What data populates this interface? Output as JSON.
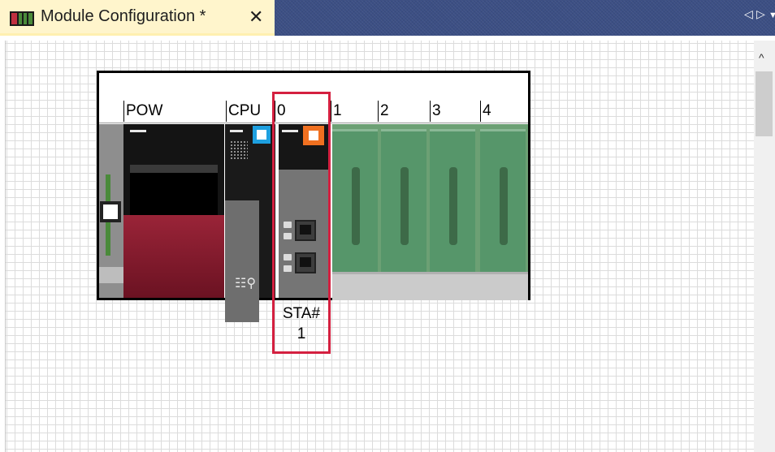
{
  "tab": {
    "title": "Module Configuration *",
    "close_glyph": "✕",
    "icon": "module-config-icon",
    "nav_left": "◁",
    "nav_right": "▷",
    "menu": "▼"
  },
  "scrollbar": {
    "up": "^"
  },
  "base": {
    "slots": [
      "POW",
      "CPU",
      "0",
      "1",
      "2",
      "3",
      "4"
    ]
  },
  "modules": {
    "cpu_icons": "☷⚲",
    "station_line1": "STA#",
    "station_line2": "1"
  },
  "colors": {
    "tab_active": "#fff5cc",
    "tabbar": "#3c4f84",
    "selection": "#d42040",
    "cpu_indicator": "#1ea0e0",
    "module0_indicator": "#f07020",
    "empty_slot": "#56966a",
    "power_unit": "#9a2438"
  }
}
